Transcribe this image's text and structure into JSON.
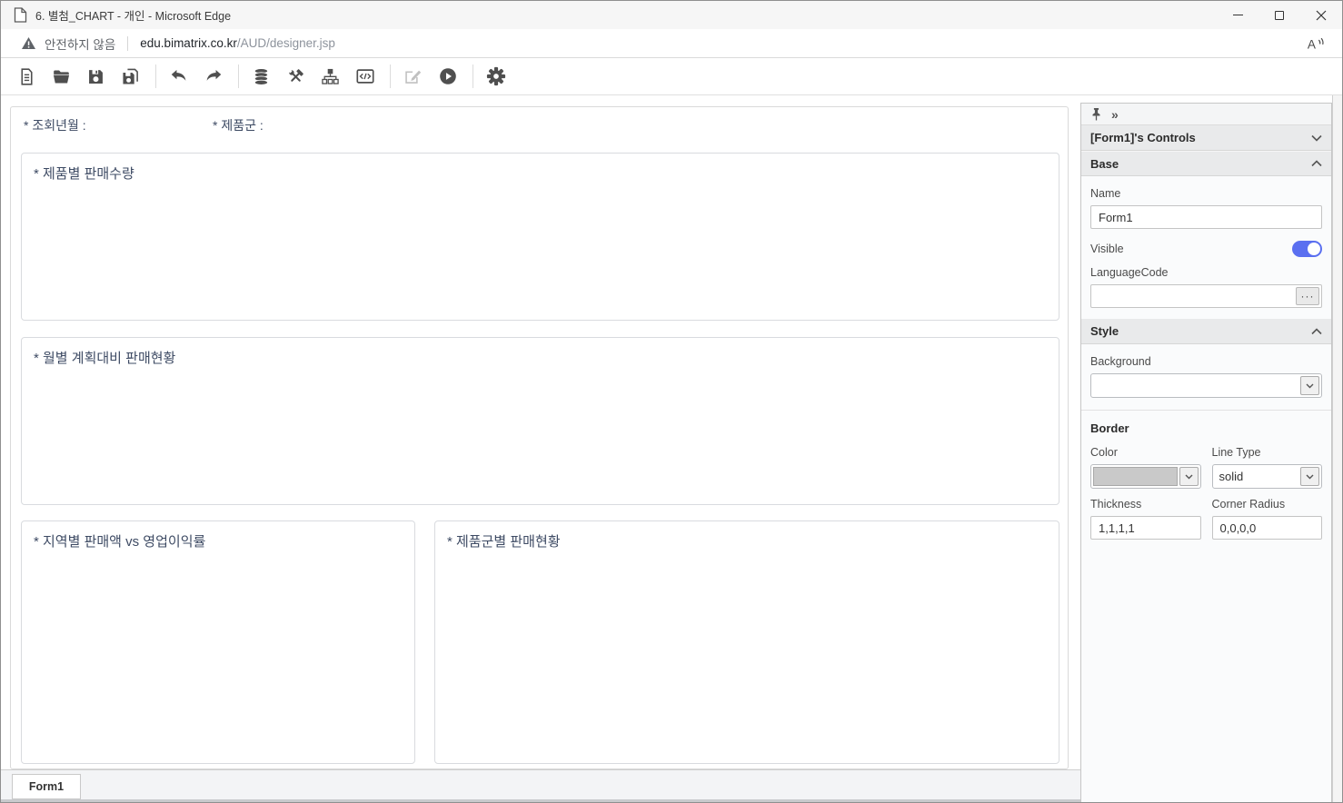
{
  "window": {
    "title": "6. 별첨_CHART - 개인 - Microsoft Edge",
    "controls": {
      "minimize": "minimize-icon",
      "maximize": "maximize-icon",
      "close": "close-icon"
    }
  },
  "address_bar": {
    "security_icon": "warning-triangle-icon",
    "security_label": "안전하지 않음",
    "url_domain": "edu.bimatrix.co.kr",
    "url_path": "/AUD/designer.jsp",
    "read_aloud_icon": "read-aloud-icon"
  },
  "toolbar": {
    "items": [
      "new-document",
      "open-folder",
      "save",
      "save-all",
      "undo",
      "redo",
      "database",
      "build-tools",
      "hierarchy",
      "code-editor",
      "edit",
      "run",
      "settings"
    ],
    "disabled_items": [
      "edit"
    ]
  },
  "canvas": {
    "filters": [
      {
        "label": "* 조회년월 :"
      },
      {
        "label": "* 제품군 :"
      }
    ],
    "panels": [
      {
        "title": "* 제품별 판매수량"
      },
      {
        "title": "* 월별 계획대비 판매현황"
      },
      {
        "title": "* 지역별 판매액 vs 영업이익률"
      },
      {
        "title": "* 제품군별 판매현황"
      }
    ]
  },
  "properties_panel": {
    "pin_icon": "pin-icon",
    "collapse_icon": "»",
    "header": "[Form1]'s Controls",
    "base": {
      "title": "Base",
      "name_label": "Name",
      "name_value": "Form1",
      "visible_label": "Visible",
      "visible_on": true,
      "language_code_label": "LanguageCode",
      "language_code_value": "",
      "browse_button": "···"
    },
    "style": {
      "title": "Style",
      "background_label": "Background",
      "background_value": "",
      "border_title": "Border",
      "color_label": "Color",
      "line_type_label": "Line Type",
      "line_type_value": "solid",
      "thickness_label": "Thickness",
      "thickness_value": "1,1,1,1",
      "corner_radius_label": "Corner Radius",
      "corner_radius_value": "0,0,0,0"
    }
  },
  "tab_bar": {
    "tabs": [
      {
        "label": "Form1",
        "active": true
      }
    ]
  },
  "colors": {
    "toggle_on": "#5a6ff0",
    "border_color_swatch": "#c9c9c9",
    "section_header_bg": "#e9eaeb",
    "canvas_text": "#3e4b64"
  }
}
